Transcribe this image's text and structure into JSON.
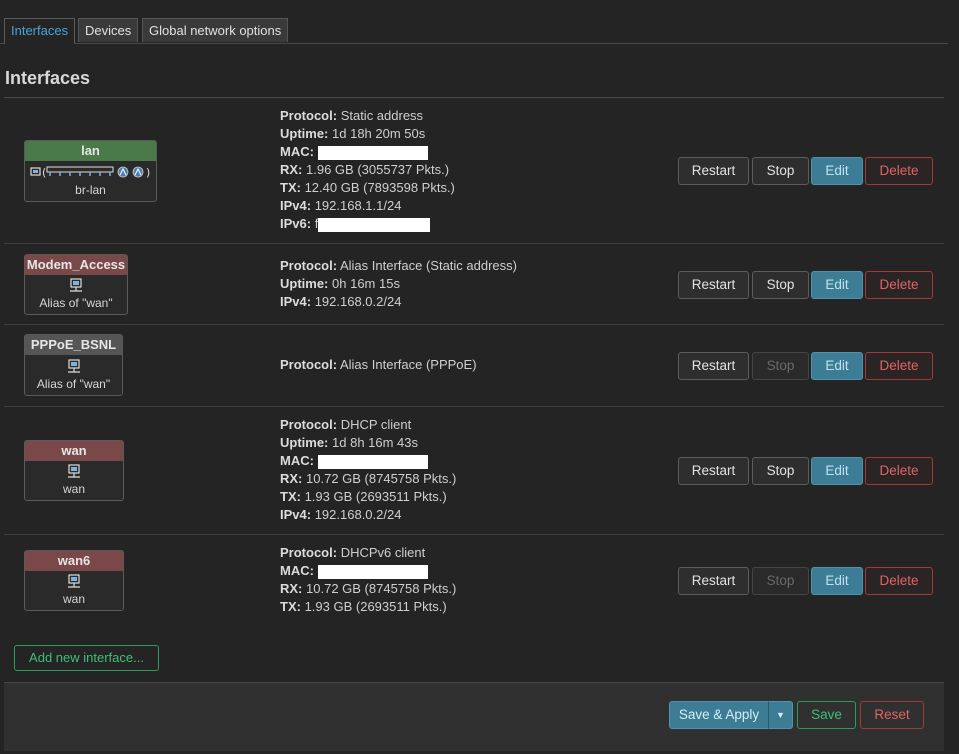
{
  "tabs": [
    {
      "label": "Interfaces",
      "active": true
    },
    {
      "label": "Devices"
    },
    {
      "label": "Global network options"
    }
  ],
  "page_title": "Interfaces",
  "labels": {
    "protocol": "Protocol:",
    "uptime": "Uptime:",
    "mac": "MAC:",
    "rx": "RX:",
    "tx": "TX:",
    "ipv4": "IPv4:",
    "ipv6": "IPv6:"
  },
  "buttons": {
    "restart": "Restart",
    "stop": "Stop",
    "edit": "Edit",
    "delete": "Delete",
    "add_interface": "Add new interface...",
    "save_apply": "Save & Apply",
    "save": "Save",
    "reset": "Reset"
  },
  "interfaces": [
    {
      "name": "lan",
      "device": "br-lan",
      "head_color": "#4a7a4a",
      "protocol": "Static address",
      "uptime": "1d 18h 20m 50s",
      "mac": "",
      "rx": "1.96 GB (3055737 Pkts.)",
      "tx": "12.40 GB (7893598 Pkts.)",
      "ipv4": "192.168.1.1/24",
      "ipv6": "f",
      "stop_enabled": true
    },
    {
      "name": "Modem_Access",
      "device": "Alias of \"wan\"",
      "head_color": "#7a4848",
      "protocol": "Alias Interface (Static address)",
      "uptime": "0h 16m 15s",
      "ipv4": "192.168.0.2/24",
      "stop_enabled": true
    },
    {
      "name": "PPPoE_BSNL",
      "device": "Alias of \"wan\"",
      "head_color": "#555555",
      "protocol": "Alias Interface (PPPoE)",
      "stop_enabled": false
    },
    {
      "name": "wan",
      "device": "wan",
      "head_color": "#7a4848",
      "protocol": "DHCP client",
      "uptime": "1d 8h 16m 43s",
      "mac": "",
      "rx": "10.72 GB (8745758 Pkts.)",
      "tx": "1.93 GB (2693511 Pkts.)",
      "ipv4": "192.168.0.2/24",
      "stop_enabled": true
    },
    {
      "name": "wan6",
      "device": "wan",
      "head_color": "#7a4848",
      "protocol": "DHCPv6 client",
      "mac": "",
      "rx": "10.72 GB (8745758 Pkts.)",
      "tx": "1.93 GB (2693511 Pkts.)",
      "stop_enabled": false
    }
  ]
}
